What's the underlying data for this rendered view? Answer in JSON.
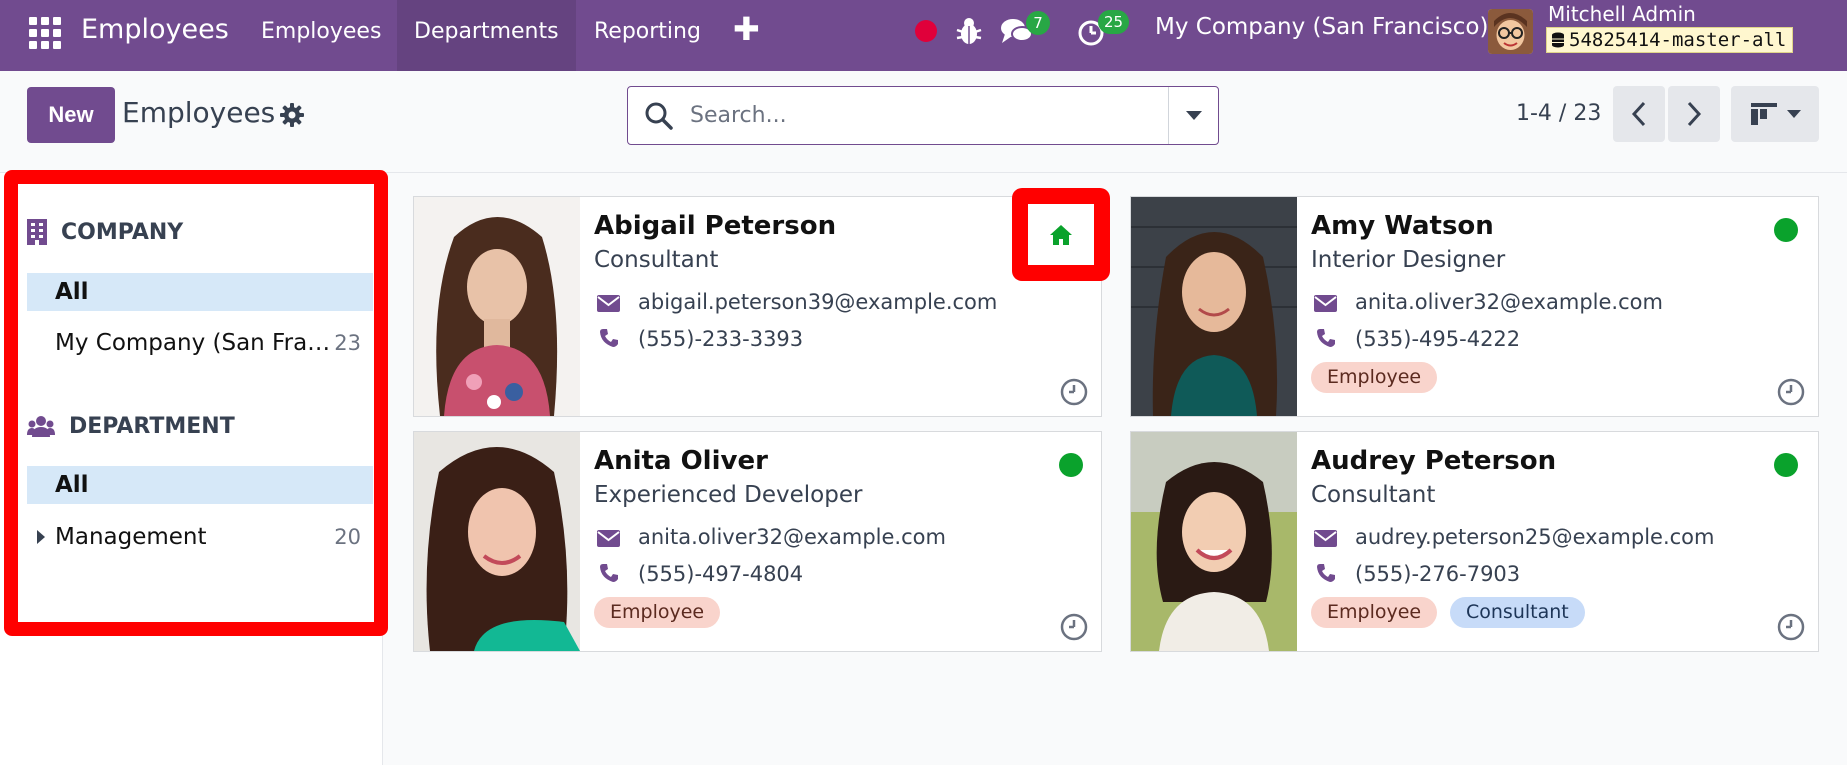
{
  "topbar": {
    "app_title": "Employees",
    "nav": [
      "Employees",
      "Departments",
      "Reporting"
    ],
    "active_nav": "Departments",
    "chat_count": "7",
    "activity_count": "25",
    "company": "My Company (San Francisco)",
    "user_name": "Mitchell Admin",
    "db_name": "54825414-master-all"
  },
  "control": {
    "new_label": "New",
    "title": "Employees",
    "search_placeholder": "Search...",
    "pager": "1-4 / 23"
  },
  "sidebar": {
    "company_heading": "COMPANY",
    "company_items": [
      {
        "label": "All",
        "count": ""
      },
      {
        "label": "My Company (San Fra…",
        "count": "23"
      }
    ],
    "department_heading": "DEPARTMENT",
    "department_items": [
      {
        "label": "All",
        "count": ""
      },
      {
        "label": "Management",
        "count": "20"
      }
    ]
  },
  "employees": [
    {
      "name": "Abigail Peterson",
      "job": "Consultant",
      "email": "abigail.peterson39@example.com",
      "phone": "(555)-233-3393",
      "tags": [],
      "status": "home"
    },
    {
      "name": "Amy Watson",
      "job": "Interior Designer",
      "email": "anita.oliver32@example.com",
      "phone": "(535)-495-4222",
      "tags": [
        "Employee"
      ],
      "status": "online"
    },
    {
      "name": "Anita Oliver",
      "job": "Experienced Developer",
      "email": "anita.oliver32@example.com",
      "phone": "(555)-497-4804",
      "tags": [
        "Employee"
      ],
      "status": "online"
    },
    {
      "name": "Audrey Peterson",
      "job": "Consultant",
      "email": "audrey.peterson25@example.com",
      "phone": "(555)-276-7903",
      "tags": [
        "Employee",
        "Consultant"
      ],
      "status": "online"
    }
  ],
  "colors": {
    "brand": "#714b8f",
    "online": "#0aa22c",
    "highlight": "#ff0000"
  }
}
